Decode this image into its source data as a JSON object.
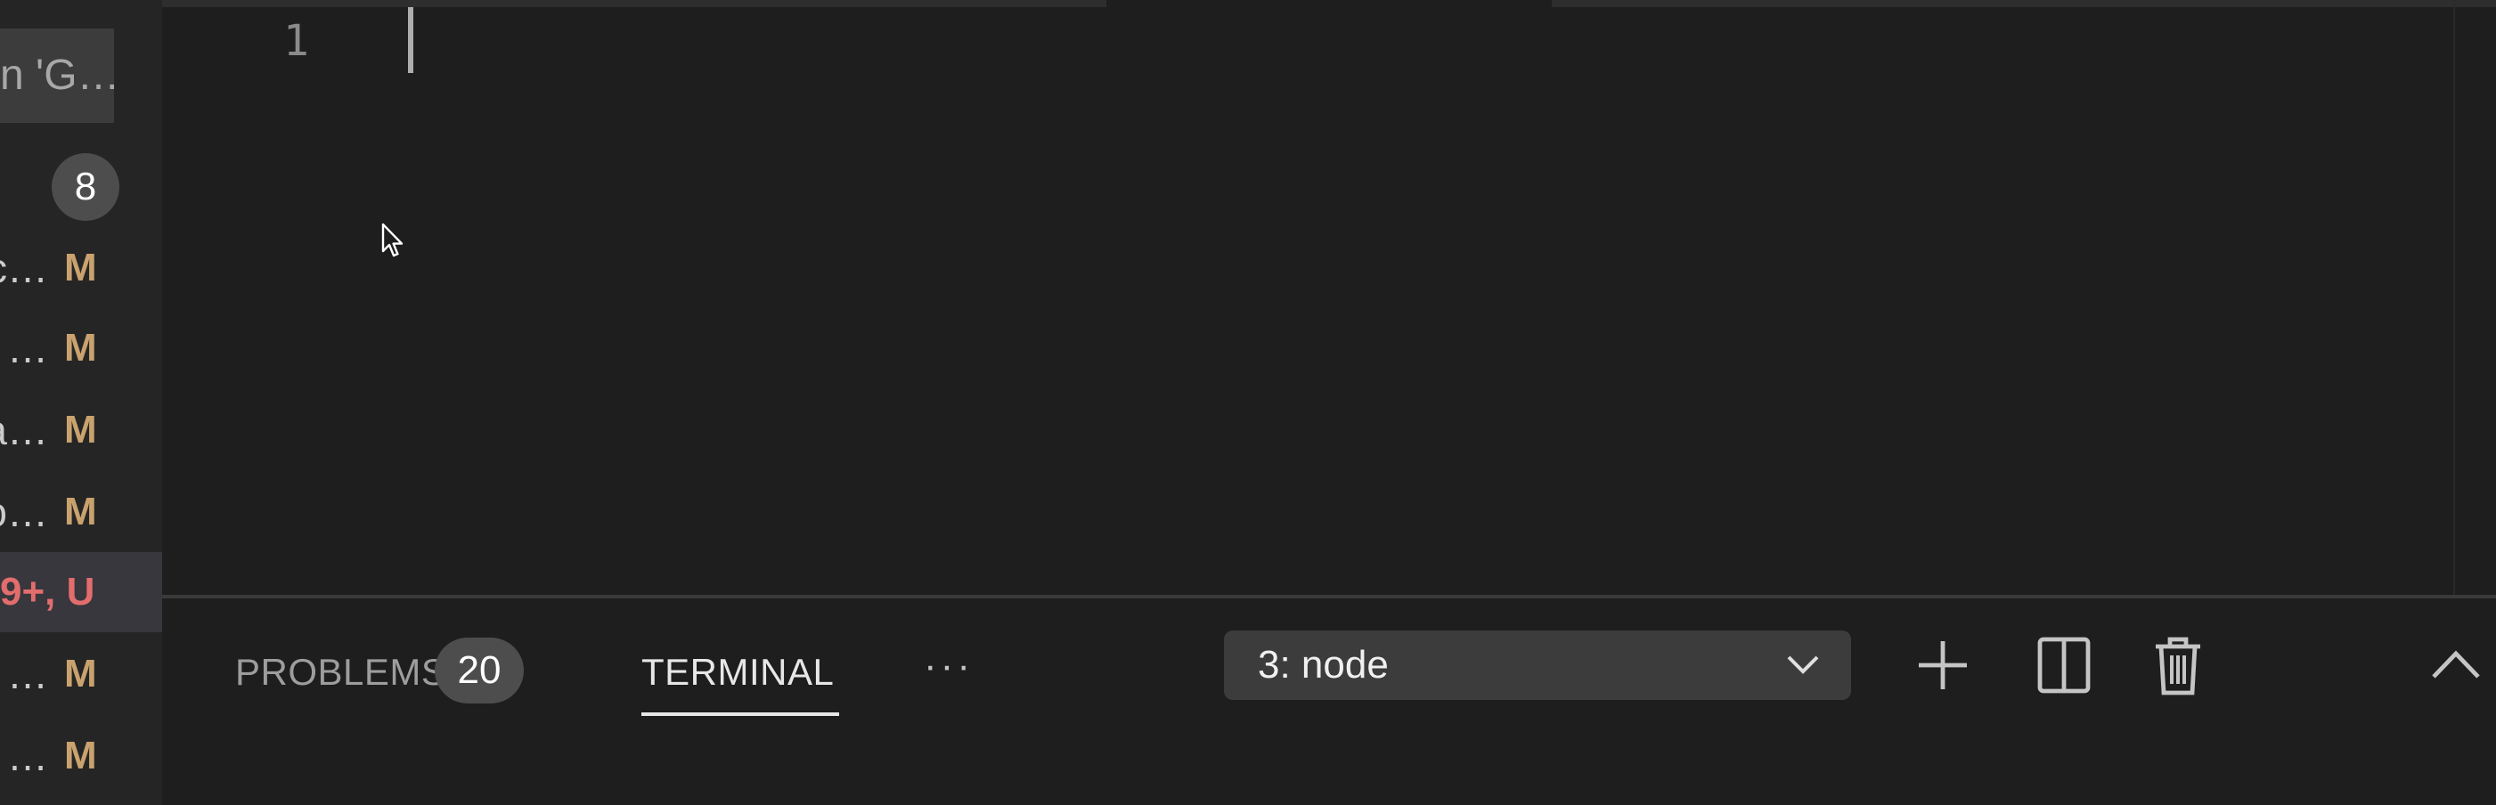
{
  "sidebar": {
    "search_value": "n 'G…",
    "changes_count": "8",
    "files": [
      {
        "name": "c…",
        "status": "M"
      },
      {
        "name": "…",
        "status": "M"
      },
      {
        "name": "a…",
        "status": "M"
      },
      {
        "name": "o…",
        "status": "M"
      },
      {
        "name": "",
        "status": "9+, U",
        "selected": true
      },
      {
        "name": "…",
        "status": "M"
      },
      {
        "name": "…",
        "status": "M"
      }
    ]
  },
  "editor": {
    "line_number": "1"
  },
  "panel": {
    "tabs": {
      "problems_label": "PROBLEMS",
      "problems_count": "20",
      "terminal_label": "TERMINAL",
      "more_label": "···"
    },
    "terminal_select": {
      "value": "3: node"
    },
    "actions": [
      "new-terminal",
      "split-terminal",
      "kill-terminal",
      "maximize-panel",
      "close-panel"
    ]
  },
  "colors": {
    "modified": "#c9a26d",
    "error": "#e26d6d",
    "badge_bg": "#4d4d4d",
    "editor_bg": "#1e1e1e",
    "sidebar_bg": "#252526"
  }
}
